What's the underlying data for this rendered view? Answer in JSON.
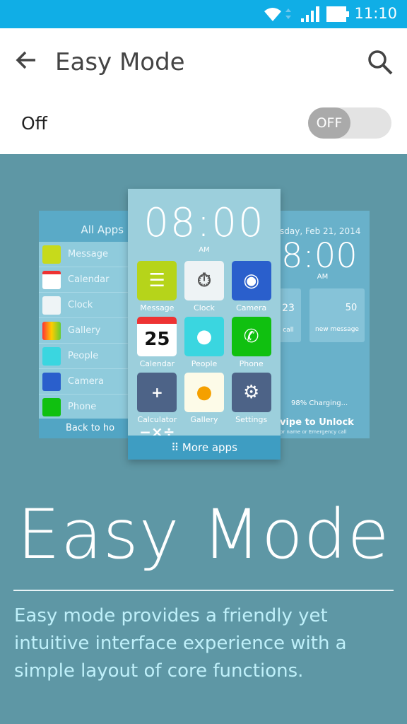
{
  "status": {
    "time": "11:10",
    "icons": [
      "wifi-icon",
      "signal-icon",
      "battery-icon"
    ],
    "color": "#10aee6"
  },
  "appbar": {
    "title": "Easy Mode",
    "back_icon": "arrow-left-icon",
    "search_icon": "search-icon"
  },
  "setting": {
    "label": "Off",
    "toggle": "OFF",
    "enabled": false
  },
  "illustration": {
    "left": {
      "header": "All Apps",
      "items": [
        "Message",
        "Calendar",
        "Clock",
        "Gallery",
        "People",
        "Camera",
        "Phone"
      ],
      "footer": "Back to ho"
    },
    "center": {
      "time": "08:00",
      "ampm": "AM",
      "apps": [
        "Message",
        "Clock",
        "Camera",
        "Calendar",
        "People",
        "Phone",
        "Calculator",
        "Gallery",
        "Settings"
      ],
      "calendar_day": "25",
      "more": "More apps"
    },
    "right": {
      "date": "sday, Feb 21, 2014",
      "time": "8:00",
      "ampm": "AM",
      "calls": "23",
      "calls_label": "call",
      "messages": "50",
      "messages_label": "new message",
      "charging": "98% Charging...",
      "unlock": "vipe to Unlock",
      "hint": "or name or Emergency call"
    }
  },
  "hero": {
    "title": "Easy Mode",
    "description": "Easy mode provides a friendly yet intuitive interface experience with a simple layout of core functions."
  }
}
